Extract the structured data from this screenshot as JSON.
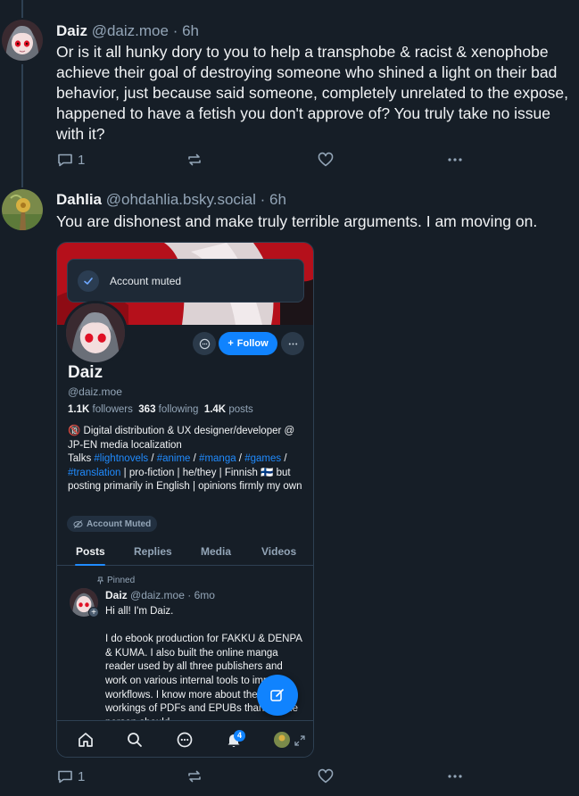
{
  "posts": [
    {
      "author": "Daiz",
      "handle": "@daiz.moe",
      "time": "· 6h",
      "text": "Or is it all hunky dory to you to help a transphobe & racist & xenophobe achieve their goal of destroying someone who shined a light on their bad behavior, just because said someone, completely unrelated to the expose, happened to have a fetish you don't approve of? You truly take no issue with it?",
      "reply_count": "1"
    },
    {
      "author": "Dahlia",
      "handle": "@ohdahlia.bsky.social",
      "time": "· 6h",
      "text": "You are dishonest and make truly terrible arguments. I am moving on.",
      "reply_count": "1"
    }
  ],
  "embed": {
    "toast": "Account muted",
    "follow_label": "Follow",
    "name": "Daiz",
    "handle": "@daiz.moe",
    "stats": {
      "followers": "1.1K",
      "followers_label": "followers",
      "following": "363",
      "following_label": "following",
      "posts": "1.4K",
      "posts_label": "posts"
    },
    "bio": {
      "line1": "🔞 Digital distribution & UX designer/developer @ JP-EN media localization",
      "talks": "Talks",
      "tag1": "#lightnovels",
      "tag2": "#anime",
      "tag3": "#manga",
      "tag4": "#games",
      "tag5": "#translation",
      "after_tags": "| pro-fiction | he/they | Finnish 🇫🇮 but posting primarily in English | opinions firmly my own"
    },
    "muted_pill": "Account Muted",
    "tabs": [
      "Posts",
      "Replies",
      "Media",
      "Videos"
    ],
    "pinned_label": "Pinned",
    "pinned_post": {
      "author": "Daiz",
      "handle": "@daiz.moe",
      "time": "· 6mo",
      "text": "Hi all! I'm Daiz.\n\nI do ebook production for FAKKU & DENPA & KUMA. I also built the online manga reader used by all three publishers and work on various internal tools to improve workflows. I know more about the inner workings of PDFs and EPUBs than a sane person should"
    },
    "notification_count": "4"
  },
  "colors": {
    "background": "#161e27",
    "accent": "#1083fe",
    "muted_text": "#93a5b7",
    "link": "#208bfe"
  }
}
